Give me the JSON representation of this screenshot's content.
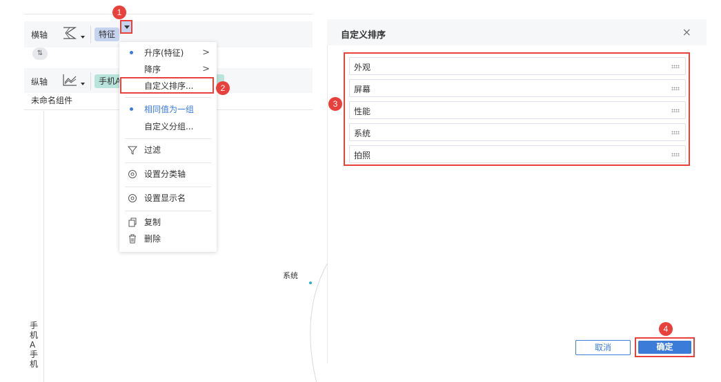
{
  "left": {
    "horizontal_axis_label": "横轴",
    "vertical_axis_label": "纵轴",
    "horizontal_field": "特征",
    "vertical_field": "手机A",
    "swap_icon": "⇅",
    "widget_title": "未命名组件",
    "y_axis_text": "手机A手机",
    "radar_label": "系统"
  },
  "menu": {
    "asc": "升序(特征)",
    "desc": "降序",
    "custom_sort": "自定义排序...",
    "same_value_group": "相同值为一组",
    "custom_group": "自定义分组...",
    "filter": "过滤",
    "set_category_axis": "设置分类轴",
    "set_display_name": "设置显示名",
    "copy": "复制",
    "delete": "删除"
  },
  "dialog": {
    "title": "自定义排序",
    "close": "×",
    "items": [
      "外观",
      "屏幕",
      "性能",
      "系统",
      "拍照"
    ],
    "cancel": "取消",
    "ok": "确定"
  },
  "badges": [
    "1",
    "2",
    "3",
    "4"
  ],
  "colors": {
    "accent": "#3b7cd9",
    "annotation": "#e8413b"
  }
}
